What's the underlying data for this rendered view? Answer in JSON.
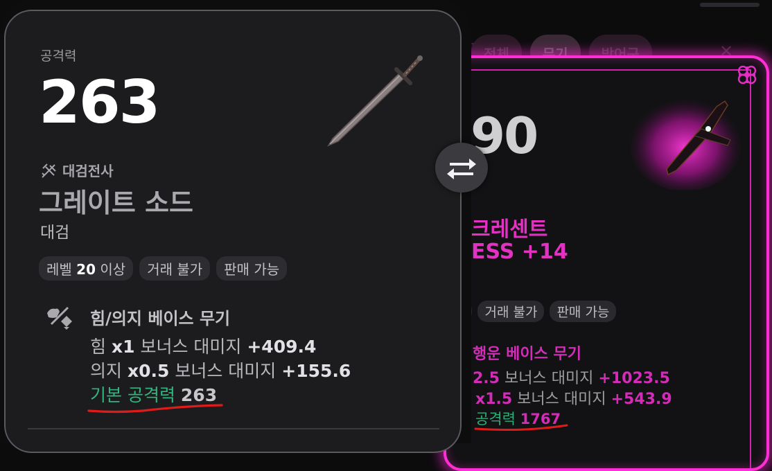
{
  "colors": {
    "magenta_accent": "#ff2fd5",
    "green_text": "#2fb67e",
    "panel_bg": "#1c1c1e",
    "underline_red": "#e01b1b"
  },
  "filter_tabs": [
    "전체",
    "무기",
    "방어구"
  ],
  "left": {
    "attack_label": "공격력",
    "attack_value": "263",
    "class_icon": "greatsword-class-icon",
    "class_label": "대검전사",
    "item_name": "그레이트 소드",
    "item_type": "대검",
    "tags": {
      "level_prefix": "레벨",
      "level_value": "20",
      "level_suffix": "이상",
      "trade": "거래 불가",
      "sell": "판매 가능"
    },
    "section": {
      "icon": "strength-will-icon",
      "title": "힘/의지 베이스 무기",
      "stat1": {
        "stat": "힘",
        "mult": "x1",
        "desc": "보너스 대미지",
        "value": "+409.4"
      },
      "stat2": {
        "stat": "의지",
        "mult": "x0.5",
        "desc": "보너스 대미지",
        "value": "+155.6"
      },
      "stat3": {
        "label": "기본 공격력",
        "value": "263"
      }
    }
  },
  "right": {
    "attack_value_partial": "90",
    "name_line1": "크레센트",
    "name_line2": "ESS +14",
    "tags": {
      "level_partial": "상",
      "trade": "거래 불가",
      "sell": "판매 가능"
    },
    "section_title": "행운 베이스 무기",
    "line1": {
      "mult": "2.5",
      "desc": "보너스 대미지",
      "value": "+1023.5"
    },
    "line2": {
      "mult": "x1.5",
      "desc": "보너스 대미지",
      "value": "+543.9"
    },
    "line3": {
      "label": "공격력",
      "value": "1767"
    }
  }
}
